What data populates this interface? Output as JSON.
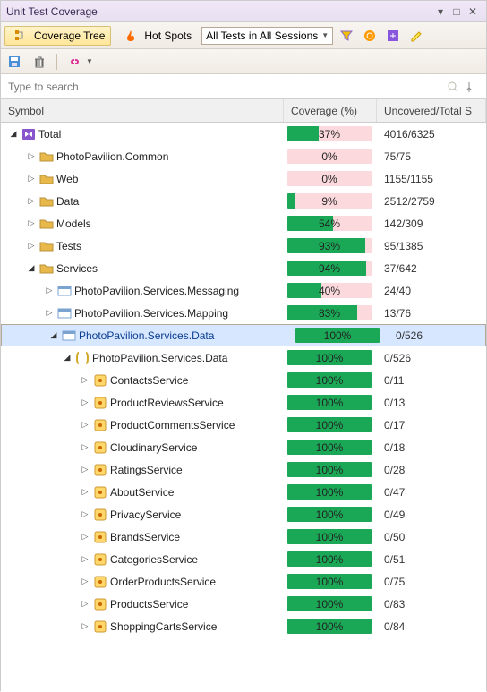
{
  "window": {
    "title": "Unit Test Coverage"
  },
  "toolbar": {
    "coverage_tree": "Coverage Tree",
    "hot_spots": "Hot Spots",
    "sessions_sel": "All Tests in All Sessions"
  },
  "search": {
    "placeholder": "Type to search"
  },
  "columns": {
    "symbol": "Symbol",
    "coverage": "Coverage (%)",
    "uncovered": "Uncovered/Total S"
  },
  "rows": [
    {
      "indent": 0,
      "exp": "open",
      "icon": "vs",
      "label": "Total",
      "pct": 37,
      "bg": "pink",
      "unc": "4016/6325",
      "sel": false
    },
    {
      "indent": 1,
      "exp": "closed",
      "icon": "folder",
      "label": "PhotoPavilion.Common",
      "pct": 0,
      "bg": "pink",
      "unc": "75/75",
      "sel": false
    },
    {
      "indent": 1,
      "exp": "closed",
      "icon": "folder",
      "label": "Web",
      "pct": 0,
      "bg": "pink",
      "unc": "1155/1155",
      "sel": false
    },
    {
      "indent": 1,
      "exp": "closed",
      "icon": "folder",
      "label": "Data",
      "pct": 9,
      "bg": "pink",
      "unc": "2512/2759",
      "sel": false
    },
    {
      "indent": 1,
      "exp": "closed",
      "icon": "folder",
      "label": "Models",
      "pct": 54,
      "bg": "pink",
      "unc": "142/309",
      "sel": false
    },
    {
      "indent": 1,
      "exp": "closed",
      "icon": "folder",
      "label": "Tests",
      "pct": 93,
      "bg": "green",
      "unc": "95/1385",
      "sel": false
    },
    {
      "indent": 1,
      "exp": "open",
      "icon": "folder",
      "label": "Services",
      "pct": 94,
      "bg": "green",
      "unc": "37/642",
      "sel": false
    },
    {
      "indent": 2,
      "exp": "closed",
      "icon": "module",
      "label": "PhotoPavilion.Services.Messaging",
      "pct": 40,
      "bg": "pink",
      "unc": "24/40",
      "sel": false
    },
    {
      "indent": 2,
      "exp": "closed",
      "icon": "module",
      "label": "PhotoPavilion.Services.Mapping",
      "pct": 83,
      "bg": "pink",
      "unc": "13/76",
      "sel": false
    },
    {
      "indent": 2,
      "exp": "open",
      "icon": "module",
      "label": "PhotoPavilion.Services.Data",
      "pct": 100,
      "bg": "green",
      "unc": "0/526",
      "sel": true
    },
    {
      "indent": 3,
      "exp": "open",
      "icon": "ns",
      "label": "PhotoPavilion.Services.Data",
      "pct": 100,
      "bg": "green",
      "unc": "0/526",
      "sel": false
    },
    {
      "indent": 4,
      "exp": "closed",
      "icon": "class",
      "label": "ContactsService",
      "pct": 100,
      "bg": "green",
      "unc": "0/11",
      "sel": false
    },
    {
      "indent": 4,
      "exp": "closed",
      "icon": "class",
      "label": "ProductReviewsService",
      "pct": 100,
      "bg": "green",
      "unc": "0/13",
      "sel": false
    },
    {
      "indent": 4,
      "exp": "closed",
      "icon": "class",
      "label": "ProductCommentsService",
      "pct": 100,
      "bg": "green",
      "unc": "0/17",
      "sel": false
    },
    {
      "indent": 4,
      "exp": "closed",
      "icon": "class",
      "label": "CloudinaryService",
      "pct": 100,
      "bg": "green",
      "unc": "0/18",
      "sel": false
    },
    {
      "indent": 4,
      "exp": "closed",
      "icon": "class",
      "label": "RatingsService",
      "pct": 100,
      "bg": "green",
      "unc": "0/28",
      "sel": false
    },
    {
      "indent": 4,
      "exp": "closed",
      "icon": "class",
      "label": "AboutService",
      "pct": 100,
      "bg": "green",
      "unc": "0/47",
      "sel": false
    },
    {
      "indent": 4,
      "exp": "closed",
      "icon": "class",
      "label": "PrivacyService",
      "pct": 100,
      "bg": "green",
      "unc": "0/49",
      "sel": false
    },
    {
      "indent": 4,
      "exp": "closed",
      "icon": "class",
      "label": "BrandsService",
      "pct": 100,
      "bg": "green",
      "unc": "0/50",
      "sel": false
    },
    {
      "indent": 4,
      "exp": "closed",
      "icon": "class",
      "label": "CategoriesService",
      "pct": 100,
      "bg": "green",
      "unc": "0/51",
      "sel": false
    },
    {
      "indent": 4,
      "exp": "closed",
      "icon": "class",
      "label": "OrderProductsService",
      "pct": 100,
      "bg": "green",
      "unc": "0/75",
      "sel": false
    },
    {
      "indent": 4,
      "exp": "closed",
      "icon": "class",
      "label": "ProductsService",
      "pct": 100,
      "bg": "green",
      "unc": "0/83",
      "sel": false
    },
    {
      "indent": 4,
      "exp": "closed",
      "icon": "class",
      "label": "ShoppingCartsService",
      "pct": 100,
      "bg": "green",
      "unc": "0/84",
      "sel": false
    }
  ]
}
